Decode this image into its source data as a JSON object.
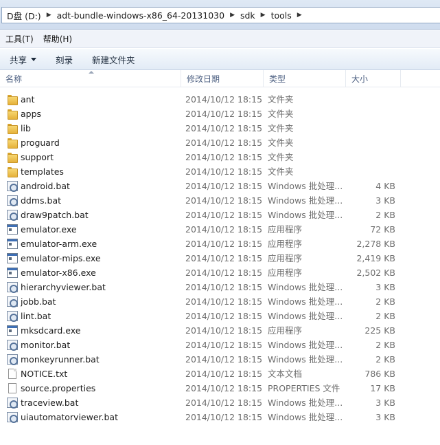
{
  "address": {
    "crumbs": [
      "D盘 (D:)",
      "adt-bundle-windows-x86_64-20131030",
      "sdk",
      "tools"
    ]
  },
  "menu": [
    "工具(T)",
    "帮助(H)"
  ],
  "toolbar": {
    "share_label": "共享",
    "burn_label": "刻录",
    "new_folder_label": "新建文件夹"
  },
  "columns": {
    "name": "名称",
    "date": "修改日期",
    "type": "类型",
    "size": "大小"
  },
  "files": [
    {
      "name": "ant",
      "date": "2014/10/12 18:15",
      "type": "文件夹",
      "size": "",
      "icon": "folder-icon"
    },
    {
      "name": "apps",
      "date": "2014/10/12 18:15",
      "type": "文件夹",
      "size": "",
      "icon": "folder-icon"
    },
    {
      "name": "lib",
      "date": "2014/10/12 18:15",
      "type": "文件夹",
      "size": "",
      "icon": "folder-icon"
    },
    {
      "name": "proguard",
      "date": "2014/10/12 18:15",
      "type": "文件夹",
      "size": "",
      "icon": "folder-icon"
    },
    {
      "name": "support",
      "date": "2014/10/12 18:15",
      "type": "文件夹",
      "size": "",
      "icon": "folder-icon"
    },
    {
      "name": "templates",
      "date": "2014/10/12 18:15",
      "type": "文件夹",
      "size": "",
      "icon": "folder-icon"
    },
    {
      "name": "android.bat",
      "date": "2014/10/12 18:15",
      "type": "Windows 批处理...",
      "size": "4 KB",
      "icon": "batch-file-icon"
    },
    {
      "name": "ddms.bat",
      "date": "2014/10/12 18:15",
      "type": "Windows 批处理...",
      "size": "3 KB",
      "icon": "batch-file-icon"
    },
    {
      "name": "draw9patch.bat",
      "date": "2014/10/12 18:15",
      "type": "Windows 批处理...",
      "size": "2 KB",
      "icon": "batch-file-icon"
    },
    {
      "name": "emulator.exe",
      "date": "2014/10/12 18:15",
      "type": "应用程序",
      "size": "72 KB",
      "icon": "application-icon"
    },
    {
      "name": "emulator-arm.exe",
      "date": "2014/10/12 18:15",
      "type": "应用程序",
      "size": "2,278 KB",
      "icon": "application-icon"
    },
    {
      "name": "emulator-mips.exe",
      "date": "2014/10/12 18:15",
      "type": "应用程序",
      "size": "2,419 KB",
      "icon": "application-icon"
    },
    {
      "name": "emulator-x86.exe",
      "date": "2014/10/12 18:15",
      "type": "应用程序",
      "size": "2,502 KB",
      "icon": "application-icon"
    },
    {
      "name": "hierarchyviewer.bat",
      "date": "2014/10/12 18:15",
      "type": "Windows 批处理...",
      "size": "3 KB",
      "icon": "batch-file-icon"
    },
    {
      "name": "jobb.bat",
      "date": "2014/10/12 18:15",
      "type": "Windows 批处理...",
      "size": "2 KB",
      "icon": "batch-file-icon"
    },
    {
      "name": "lint.bat",
      "date": "2014/10/12 18:15",
      "type": "Windows 批处理...",
      "size": "2 KB",
      "icon": "batch-file-icon"
    },
    {
      "name": "mksdcard.exe",
      "date": "2014/10/12 18:15",
      "type": "应用程序",
      "size": "225 KB",
      "icon": "application-icon"
    },
    {
      "name": "monitor.bat",
      "date": "2014/10/12 18:15",
      "type": "Windows 批处理...",
      "size": "2 KB",
      "icon": "batch-file-icon"
    },
    {
      "name": "monkeyrunner.bat",
      "date": "2014/10/12 18:15",
      "type": "Windows 批处理...",
      "size": "2 KB",
      "icon": "batch-file-icon"
    },
    {
      "name": "NOTICE.txt",
      "date": "2014/10/12 18:15",
      "type": "文本文档",
      "size": "786 KB",
      "icon": "text-document-icon"
    },
    {
      "name": "source.properties",
      "date": "2014/10/12 18:15",
      "type": "PROPERTIES 文件",
      "size": "17 KB",
      "icon": "properties-file-icon"
    },
    {
      "name": "traceview.bat",
      "date": "2014/10/12 18:15",
      "type": "Windows 批处理...",
      "size": "3 KB",
      "icon": "batch-file-icon"
    },
    {
      "name": "uiautomatorviewer.bat",
      "date": "2014/10/12 18:15",
      "type": "Windows 批处理...",
      "size": "3 KB",
      "icon": "batch-file-icon"
    }
  ]
}
